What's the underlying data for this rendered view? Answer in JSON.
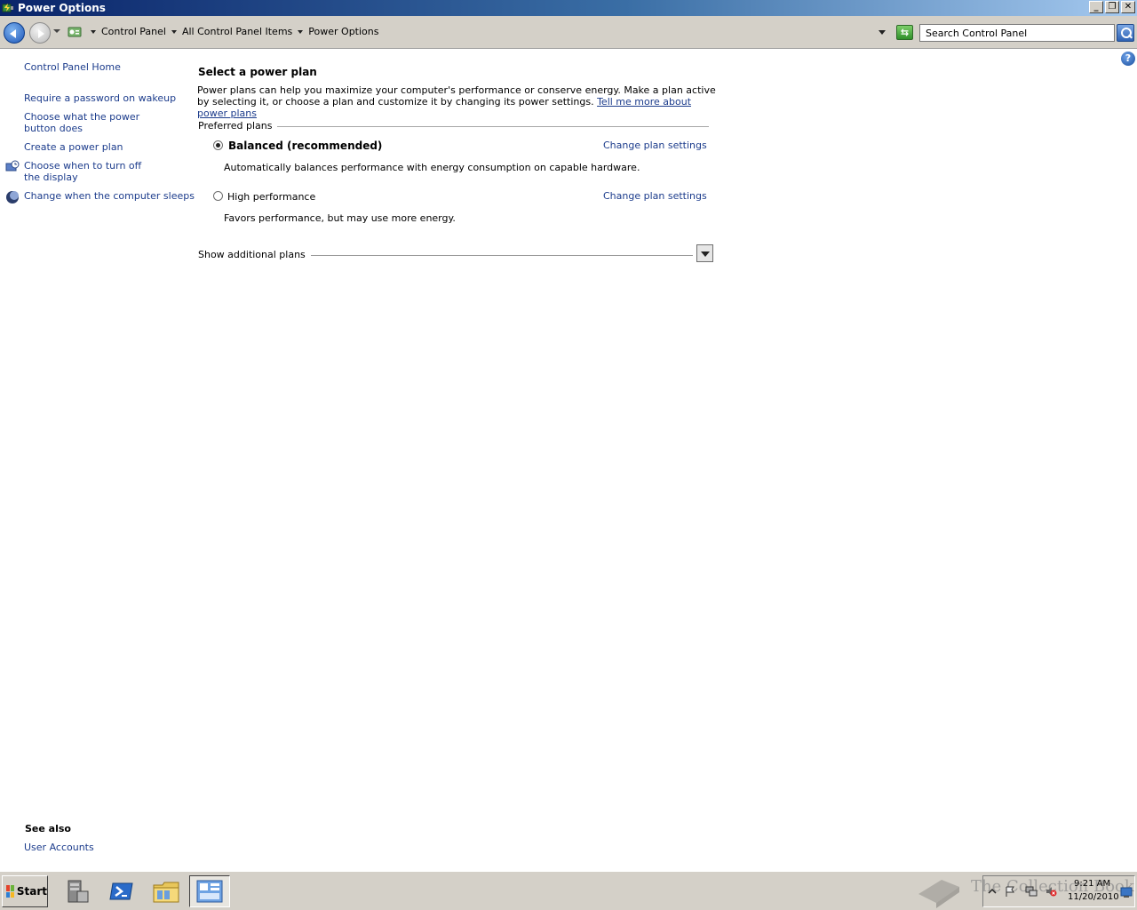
{
  "window": {
    "title": "Power Options"
  },
  "address": {
    "crumbs": [
      "Control Panel",
      "All Control Panel Items",
      "Power Options"
    ],
    "search_placeholder": "Search Control Panel"
  },
  "left_pane": {
    "home": "Control Panel Home",
    "links": [
      "Require a password on wakeup",
      "Choose what the power button does",
      "Create a power plan",
      "Choose when to turn off the display",
      "Change when the computer sleeps"
    ],
    "see_also_title": "See also",
    "see_also": [
      "User Accounts"
    ]
  },
  "main": {
    "title": "Select a power plan",
    "intro": "Power plans can help you maximize your computer's performance or conserve energy. Make a plan active by selecting it, or choose a plan and customize it by changing its power settings.",
    "intro_link": "Tell me more about power plans",
    "group_label": "Preferred plans",
    "plans": [
      {
        "name": "Balanced (recommended)",
        "selected": true,
        "description": "Automatically balances performance with energy consumption on capable hardware.",
        "link": "Change plan settings"
      },
      {
        "name": "High performance",
        "selected": false,
        "description": "Favors performance, but may use more energy.",
        "link": "Change plan settings"
      }
    ],
    "additional_label": "Show additional plans"
  },
  "taskbar": {
    "start_label": "Start",
    "apps": [
      "server-manager-icon",
      "powershell-icon",
      "explorer-icon",
      "control-panel-icon"
    ],
    "clock_time": "9:21 AM",
    "clock_date": "11/20/2010",
    "watermark": "The Collection Book"
  },
  "colors": {
    "link": "#1c3c8c",
    "titlebar": "#0a246a",
    "chrome": "#d4d0c8"
  }
}
